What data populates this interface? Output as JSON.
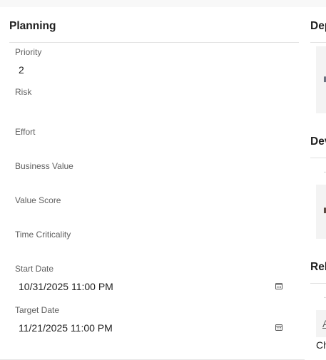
{
  "planning": {
    "title": "Planning",
    "priority": {
      "label": "Priority",
      "value": "2"
    },
    "risk": {
      "label": "Risk",
      "value": ""
    },
    "effort": {
      "label": "Effort",
      "value": ""
    },
    "business_value": {
      "label": "Business Value",
      "value": ""
    },
    "value_score": {
      "label": "Value Score",
      "value": ""
    },
    "time_criticality": {
      "label": "Time Criticality",
      "value": ""
    },
    "start_date": {
      "label": "Start Date",
      "value": "10/31/2025 11:00 PM"
    },
    "target_date": {
      "label": "Target Date",
      "value": "11/21/2025 11:00 PM"
    }
  },
  "right_panel": {
    "section1_title": "Dep",
    "section2_title": "Dev",
    "section3_title": "Rel",
    "link_text": "A",
    "footer_text": "Ch"
  },
  "icons": {
    "date_picker": "calendar-icon"
  },
  "colors": {
    "label": "#5f5f5f",
    "text": "#1f1f1f",
    "divider": "#e1e1e1",
    "page_bg": "#f8f8f8"
  }
}
